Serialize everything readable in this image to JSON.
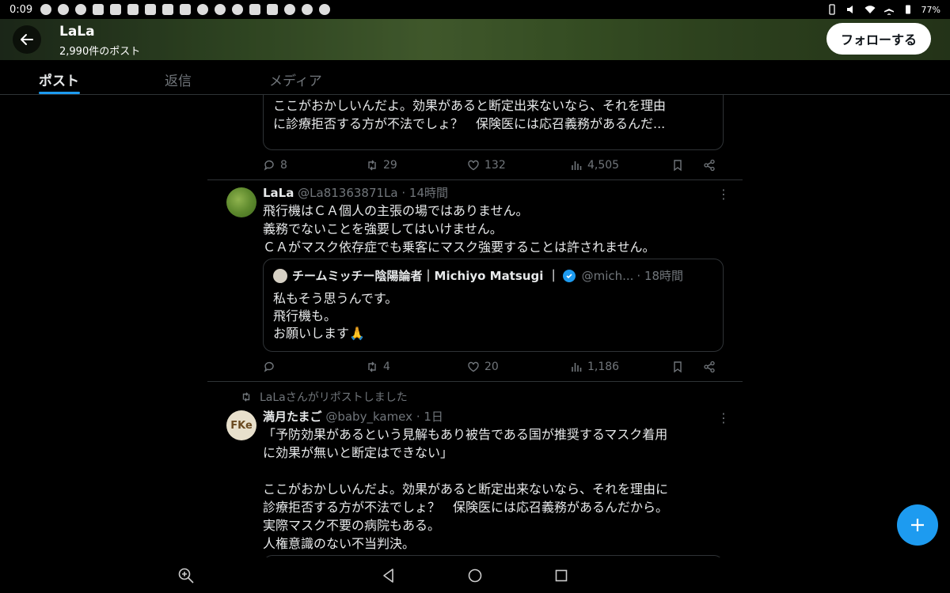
{
  "status_bar": {
    "time": "0:09",
    "battery": "77%"
  },
  "header": {
    "title": "LaLa",
    "subtitle": "2,990件のポスト",
    "follow_label": "フォローする"
  },
  "tabs": [
    {
      "label": "ポスト",
      "active": true
    },
    {
      "label": "返信",
      "active": false
    },
    {
      "label": "メディア",
      "active": false
    }
  ],
  "post0": {
    "quote_lines": [
      "ここがおかしいんだよ。効果があると断定出来ないなら、それを理由",
      "に診療拒否する方が不法でしょ？　保険医には応召義務があるんだ..."
    ],
    "replies": "8",
    "reposts": "29",
    "likes": "132",
    "views": "4,505"
  },
  "post1": {
    "name": "LaLa",
    "handle": "@La81363871La",
    "time": "· 14時間",
    "lines": [
      "飛行機はＣＡ個人の主張の場ではありません。",
      "義務でないことを強要してはいけません。",
      "ＣＡがマスク依存症でも乗客にマスク強要することは許されません。"
    ],
    "quote": {
      "name": "チームミッチー陰陽論者｜Michiyo Matsugi ｜",
      "handle": "@mich...",
      "time": "· 18時間",
      "lines": [
        "私もそう思うんです。",
        "飛行機も。",
        "お願いします"
      ],
      "emoji": "🙏"
    },
    "replies": "",
    "reposts": "4",
    "likes": "20",
    "views": "1,186"
  },
  "post2": {
    "repost_label": "LaLaさんがリポストしました",
    "name": "満月たまご",
    "handle": "@baby_kamex",
    "time": "· 1日",
    "avatar_text": "FKe",
    "lines": [
      "「予防効果があるという見解もあり被告である国が推奨するマスク着用",
      "に効果が無いと断定はできない」",
      "",
      "ここがおかしいんだよ。効果があると断定出来ないなら、それを理由に",
      "診療拒否する方が不法でしょ？　保険医には応召義務があるんだから。",
      "実際マスク不要の病院もある。",
      "人権意識のない不当判決。"
    ]
  },
  "colors": {
    "accent": "#1d9bf0",
    "muted": "#71767b",
    "border": "#2f3336"
  },
  "icons": [
    "back-arrow-icon",
    "reply-icon",
    "repost-icon",
    "like-icon",
    "views-icon",
    "bookmark-icon",
    "share-icon",
    "more-icon",
    "verified-icon",
    "plus-icon",
    "zoom-icon",
    "nav-back-icon",
    "nav-home-icon",
    "nav-recents-icon"
  ]
}
